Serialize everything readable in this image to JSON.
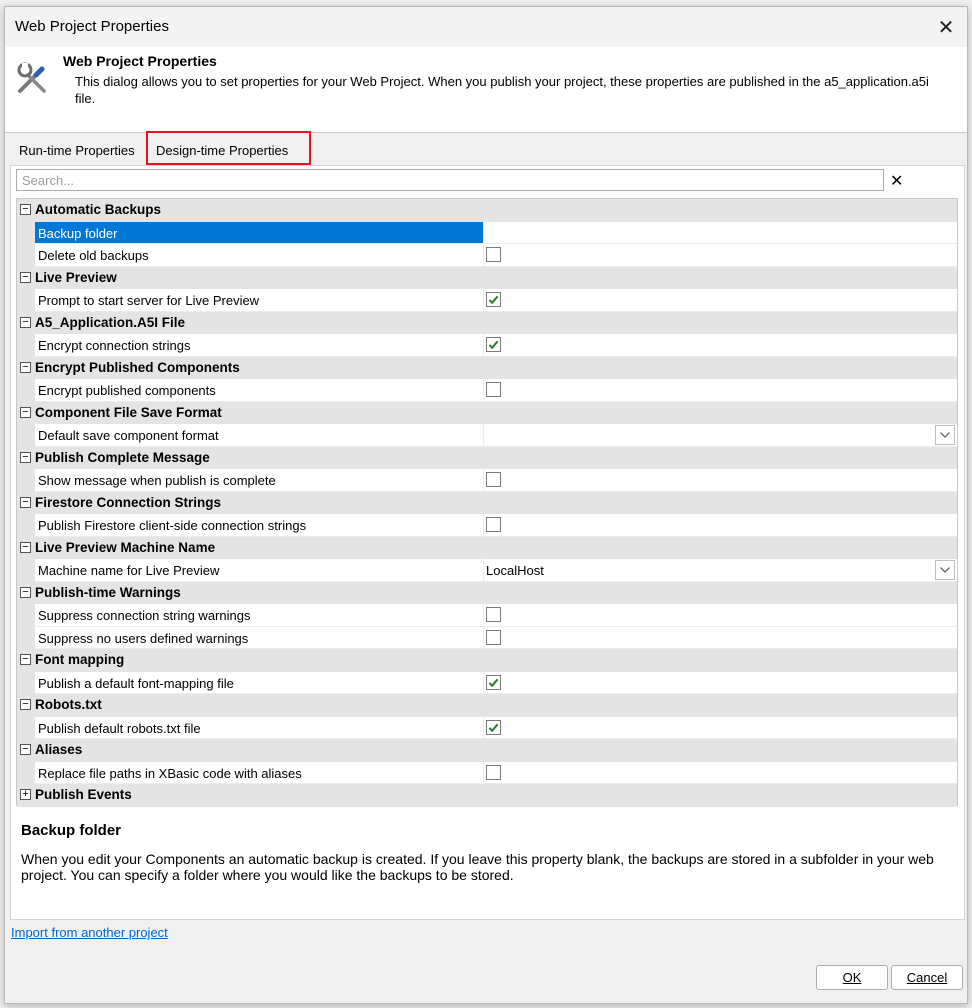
{
  "window": {
    "title": "Web Project Properties"
  },
  "header": {
    "title": "Web Project Properties",
    "description": "This dialog allows you to set properties for your Web Project. When you publish your project, these properties are published in the a5_application.a5i file."
  },
  "tabs": [
    {
      "label": "Run-time Properties",
      "selected": false
    },
    {
      "label": "Design-time Properties",
      "selected": true,
      "highlighted": true
    }
  ],
  "search": {
    "placeholder": "Search..."
  },
  "grid": {
    "rows": [
      {
        "type": "category",
        "label": "Automatic Backups",
        "expanded": true
      },
      {
        "type": "property",
        "label": "Backup folder",
        "editor": "text",
        "value": "",
        "selected": true
      },
      {
        "type": "property",
        "label": "Delete old backups",
        "editor": "checkbox",
        "checked": false
      },
      {
        "type": "category",
        "label": "Live Preview",
        "expanded": true
      },
      {
        "type": "property",
        "label": "Prompt to start server for Live Preview",
        "editor": "checkbox",
        "checked": true
      },
      {
        "type": "category",
        "label": "A5_Application.A5I File",
        "expanded": true
      },
      {
        "type": "property",
        "label": "Encrypt connection strings",
        "editor": "checkbox",
        "checked": true
      },
      {
        "type": "category",
        "label": "Encrypt Published Components",
        "expanded": true
      },
      {
        "type": "property",
        "label": "Encrypt published components",
        "editor": "checkbox",
        "checked": false
      },
      {
        "type": "category",
        "label": "Component File Save Format",
        "expanded": true
      },
      {
        "type": "property",
        "label": "Default save component format",
        "editor": "dropdown",
        "value": ""
      },
      {
        "type": "category",
        "label": "Publish Complete Message",
        "expanded": true
      },
      {
        "type": "property",
        "label": "Show message when publish is complete",
        "editor": "checkbox",
        "checked": false
      },
      {
        "type": "category",
        "label": "Firestore Connection Strings",
        "expanded": true
      },
      {
        "type": "property",
        "label": "Publish Firestore client-side connection strings",
        "editor": "checkbox",
        "checked": false
      },
      {
        "type": "category",
        "label": "Live Preview Machine Name",
        "expanded": true
      },
      {
        "type": "property",
        "label": "Machine name for Live Preview",
        "editor": "dropdown",
        "value": "LocalHost"
      },
      {
        "type": "category",
        "label": "Publish-time Warnings",
        "expanded": true
      },
      {
        "type": "property",
        "label": "Suppress connection string warnings",
        "editor": "checkbox",
        "checked": false
      },
      {
        "type": "property",
        "label": "Suppress no users defined warnings",
        "editor": "checkbox",
        "checked": false
      },
      {
        "type": "category",
        "label": "Font mapping",
        "expanded": true
      },
      {
        "type": "property",
        "label": "Publish a default font-mapping file",
        "editor": "checkbox",
        "checked": true
      },
      {
        "type": "category",
        "label": "Robots.txt",
        "expanded": true
      },
      {
        "type": "property",
        "label": "Publish default robots.txt file",
        "editor": "checkbox",
        "checked": true
      },
      {
        "type": "category",
        "label": "Aliases",
        "expanded": true
      },
      {
        "type": "property",
        "label": "Replace file paths in XBasic code with aliases",
        "editor": "checkbox",
        "checked": false
      },
      {
        "type": "category",
        "label": "Publish Events",
        "expanded": false
      }
    ]
  },
  "description": {
    "title": "Backup folder",
    "text": "When you edit your Components an automatic backup is created. If you leave this property blank, the backups are stored in a subfolder in your web project. You can specify a folder where you would like the backups to be stored."
  },
  "footer": {
    "import_link": "Import from another project",
    "ok_label": "OK",
    "cancel_label": "Cancel"
  },
  "colors": {
    "selection": "#0078d7",
    "checkmark": "#2e7d32",
    "tab_highlight": "#e81123",
    "link": "#0066cc"
  },
  "icons": {
    "header": "tools-icon",
    "close": "close-icon",
    "search_clear": "clear-icon",
    "checkbox_checked": "check-icon",
    "dropdown": "chevron-down-icon",
    "category_collapse": "minus-box-icon",
    "category_expand": "plus-box-icon"
  }
}
